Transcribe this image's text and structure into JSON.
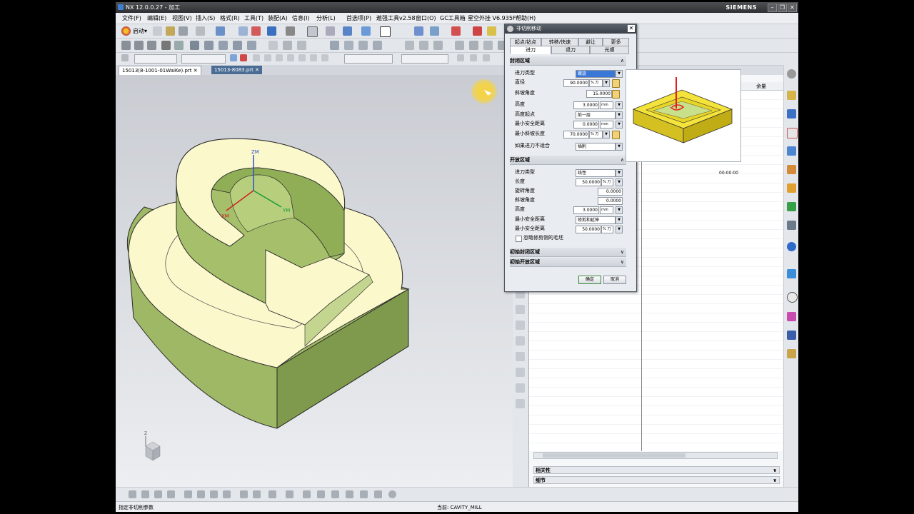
{
  "window": {
    "title": "NX 12.0.0.27 - 加工",
    "logo": "SIEMENS",
    "controls": [
      "–",
      "❐",
      "✕"
    ]
  },
  "menu": [
    "文件(F)",
    "编辑(E)",
    "视图(V)",
    "插入(S)",
    "格式(R)",
    "工具(T)",
    "装配(A)",
    "信息(I)",
    "分析(L)",
    "首选项(P)",
    "遨强工具v2.58",
    "窗口(O)",
    "GC工具箱",
    "星空外挂 V6.935F",
    "帮助(H)"
  ],
  "toolbar": {
    "start_label": "启动▾"
  },
  "tabs": [
    {
      "label": "15013(8-1001-01WaiKe).prt",
      "active": true
    },
    {
      "label": "15013-8083.prt",
      "active": false
    }
  ],
  "model": {
    "axis_z": "ZM",
    "axis_y": "YM",
    "axis_x": "XM",
    "triad_z": "Z",
    "body_color": "#a7c06e",
    "top_color": "#fbf8cc"
  },
  "dialog": {
    "title": "非切削移动",
    "tabs_row1": [
      "起点/钻点",
      "转移/快速",
      "避让",
      "更多"
    ],
    "tabs_row2": [
      "进刀",
      "退刀",
      "光顺"
    ],
    "closed_section": "封闭区域",
    "closed_rows": [
      {
        "label": "进刀类型",
        "value": "螺旋"
      },
      {
        "label": "直径",
        "value": "90.0000",
        "unit": "% 刀具"
      },
      {
        "label": "斜坡角度",
        "value": "15.0000"
      },
      {
        "label": "高度",
        "value": "3.0000",
        "unit": "mm"
      },
      {
        "label": "高度起点",
        "value": "前一层"
      },
      {
        "label": "最小安全距离",
        "value": "0.0000",
        "unit": "mm"
      },
      {
        "label": "最小斜坡长度",
        "value": "70.0000",
        "unit": "% 刀具"
      },
      {
        "label": "如果进刀不适合",
        "value": "插削"
      }
    ],
    "open_section": "开放区域",
    "open_rows": [
      {
        "label": "进刀类型",
        "value": "线性"
      },
      {
        "label": "长度",
        "value": "50.0000",
        "unit": "% 刀具"
      },
      {
        "label": "旋转角度",
        "value": "0.0000"
      },
      {
        "label": "斜坡角度",
        "value": "0.0000"
      },
      {
        "label": "高度",
        "value": "3.0000",
        "unit": "mm"
      },
      {
        "label": "最小安全距离",
        "value": "修剪和延伸"
      },
      {
        "label": "最小安全距离",
        "value": "50.0000",
        "unit": "% 刀具"
      }
    ],
    "checkbox_label": "忽略修剪侧的毛坯",
    "initial_closed": "初始封闭区域",
    "initial_open": "初始开放区域",
    "ok_label": "确定",
    "cancel_label": "取消"
  },
  "navigator": {
    "col_header": "余量",
    "time_value": "00:00:00",
    "bottom_sections": [
      "相关性",
      "细节"
    ]
  },
  "status": {
    "left": "指定非切削参数",
    "center": "当前: CAVITY_MILL"
  }
}
